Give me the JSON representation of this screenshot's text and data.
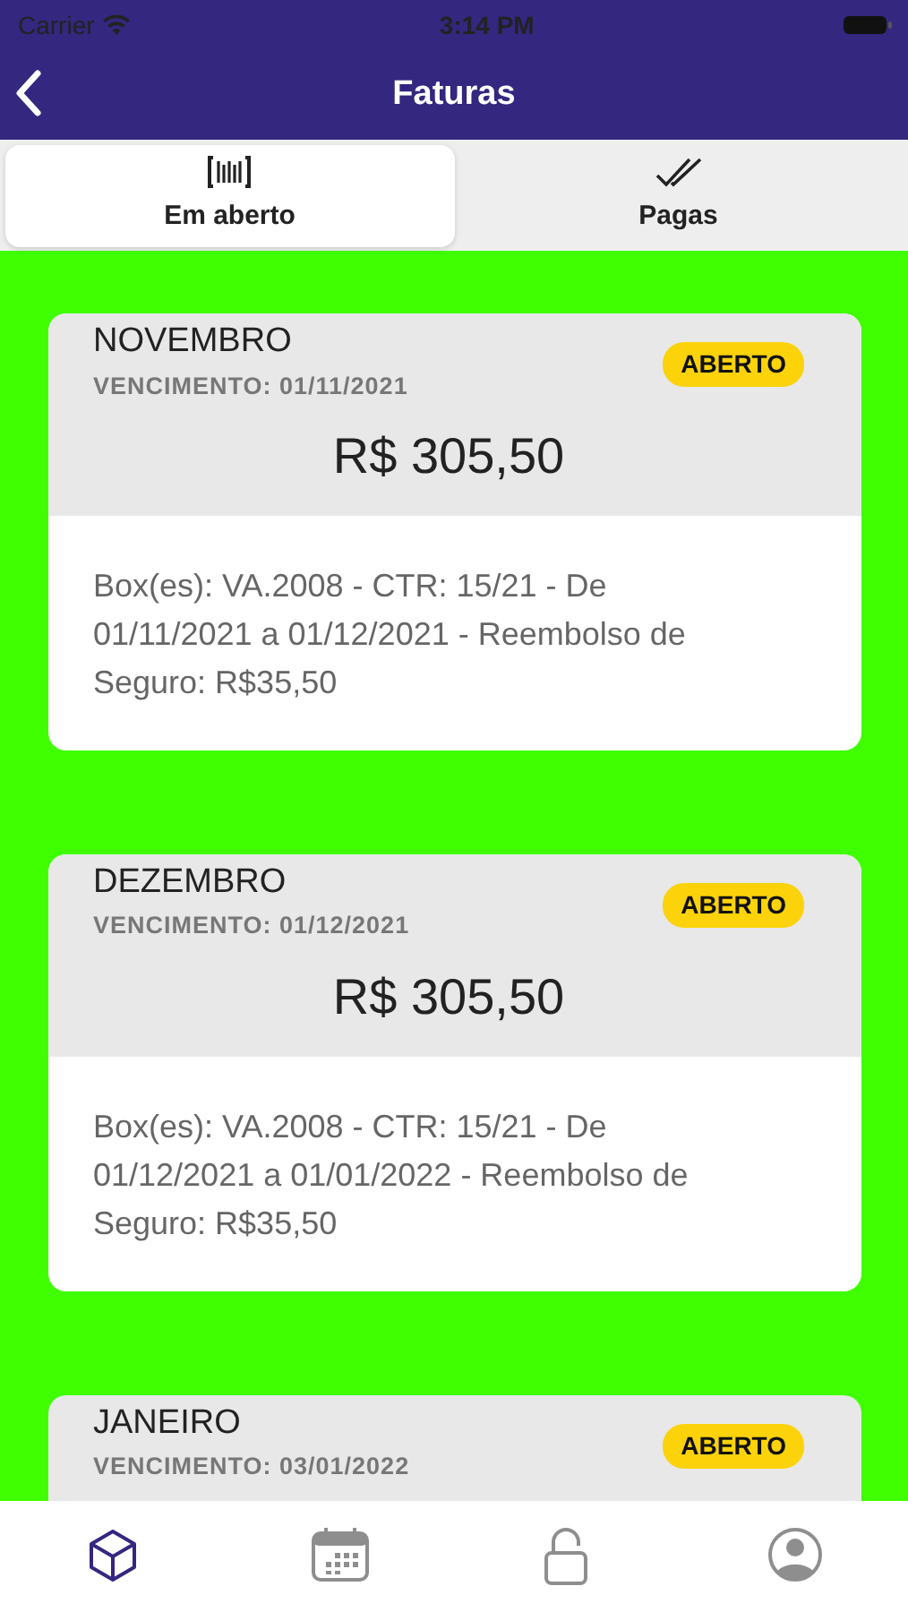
{
  "status_bar": {
    "carrier": "Carrier",
    "time": "3:14 PM"
  },
  "nav_bar": {
    "title": "Faturas"
  },
  "segments": [
    {
      "label": "Em aberto",
      "selected": true
    },
    {
      "label": "Pagas",
      "selected": false
    }
  ],
  "invoices": [
    {
      "month": "NOVEMBRO",
      "due": "VENCIMENTO: 01/11/2021",
      "status": "ABERTO",
      "amount": "R$ 305,50",
      "description": "Box(es): VA.2008 - CTR: 15/21 - De 01/11/2021 a 01/12/2021 - Reembolso de Seguro: R$35,50"
    },
    {
      "month": "DEZEMBRO",
      "due": "VENCIMENTO: 01/12/2021",
      "status": "ABERTO",
      "amount": "R$ 305,50",
      "description": "Box(es): VA.2008 - CTR: 15/21 - De 01/12/2021 a 01/01/2022 - Reembolso de Seguro: R$35,50"
    },
    {
      "month": "JANEIRO",
      "due": "VENCIMENTO: 03/01/2022",
      "status": "ABERTO"
    }
  ],
  "tab_bar": [
    {
      "selected": true
    },
    {
      "selected": false
    },
    {
      "selected": false
    },
    {
      "selected": false
    }
  ]
}
